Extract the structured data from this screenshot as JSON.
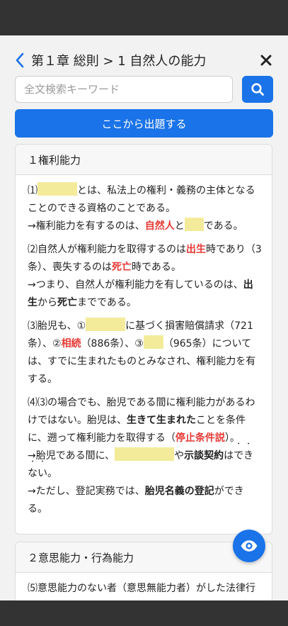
{
  "header": {
    "title": "第１章 総則 > 1 自然人の能力"
  },
  "search": {
    "placeholder": "全文検索キーワード",
    "value": ""
  },
  "actions": {
    "start_label": "ここから出題する"
  },
  "sections": [
    {
      "title": "１権利能力",
      "items": {
        "p1": {
          "num": "⑴",
          "a": "とは、私法上の権利・義務の主体となることのできる資格のことである。",
          "b": "→権利能力を有するのは、",
          "c": "自然人",
          "d": "と",
          "e": "である。"
        },
        "p2": {
          "a": "⑵自然人が権利能力を取得するのは",
          "b": "出生",
          "c": "時であり（3条）、喪失するのは",
          "d": "死亡",
          "e": "時である。",
          "f": "→つまり、自然人が権利能力を有しているのは、",
          "g": "出生",
          "h": "から",
          "i": "死亡",
          "j": "までである。"
        },
        "p3": {
          "a": "⑶胎児も、①",
          "b": "に基づく損害賠償請求（721条）、②",
          "c": "相続",
          "d": "（886条）、③",
          "e": "（965条）については、すでに生まれたものとみなされ、権利能力を有する。"
        },
        "p4": {
          "a": "⑷⑶の場合でも、胎児である間に権利能力があるわけではない。胎児は、",
          "b": "生きて生まれた",
          "c": "ことを条件に、遡って権利能力を取得する（",
          "d": "停止条件説",
          "e": "）。",
          "f": "→胎児である間に、",
          "g": "や",
          "h1": "示談契約",
          "h2": "は",
          "h3": "で",
          "h4": "き",
          "h5": "な",
          "h6": "い",
          "i": "。",
          "j": "→ただし、登記実務では、",
          "k": "胎児名義の登記",
          "l": "ができる。"
        }
      }
    },
    {
      "title": "２意思能力・行為能力",
      "preview": "⑸意思能力のない者（意思無能力者）がした法律行"
    }
  ],
  "icons": {
    "back": "chevron-left-icon",
    "close": "close-icon",
    "search": "search-icon",
    "eye": "eye-icon"
  },
  "colors": {
    "accent": "#1a73e8",
    "highlight_red": "#e53935",
    "blank_fill": "#f3eb9a",
    "system_bar": "#333333"
  }
}
